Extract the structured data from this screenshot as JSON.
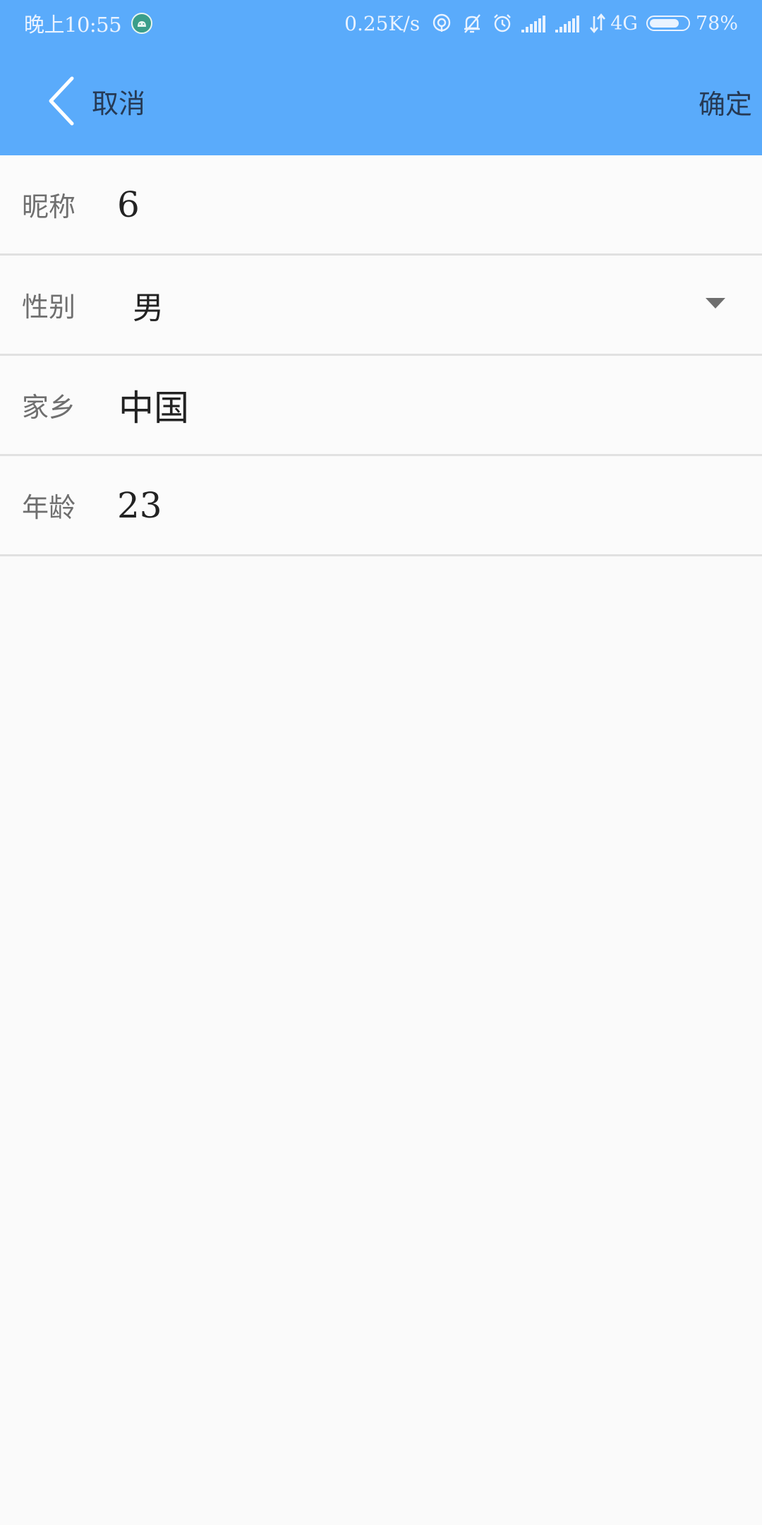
{
  "status_bar": {
    "time": "晚上10:55",
    "net_speed": "0.25K/s",
    "network": "4G",
    "battery": "78%",
    "battery_level": 0.78,
    "icons": [
      "android-icon",
      "hotspot-icon",
      "mute-icon",
      "alarm-icon",
      "signal-icon",
      "signal-icon",
      "data-transfer-icon",
      "battery-icon"
    ]
  },
  "toolbar": {
    "back_label": "取消",
    "confirm_label": "确定",
    "back_icon": "chevron-left-icon"
  },
  "form": {
    "nickname": {
      "label": "昵称",
      "value": "6"
    },
    "gender": {
      "label": "性别",
      "value": "男",
      "icon": "dropdown-arrow-icon"
    },
    "hometown": {
      "label": "家乡",
      "value": "中国"
    },
    "age": {
      "label": "年龄",
      "value": "23"
    }
  },
  "colors": {
    "primary": "#5aabfb",
    "background": "#fafafa",
    "divider": "#e1e1e1",
    "label_text": "#6f6f6f",
    "value_text": "#222222",
    "toolbar_text": "#263a55"
  }
}
